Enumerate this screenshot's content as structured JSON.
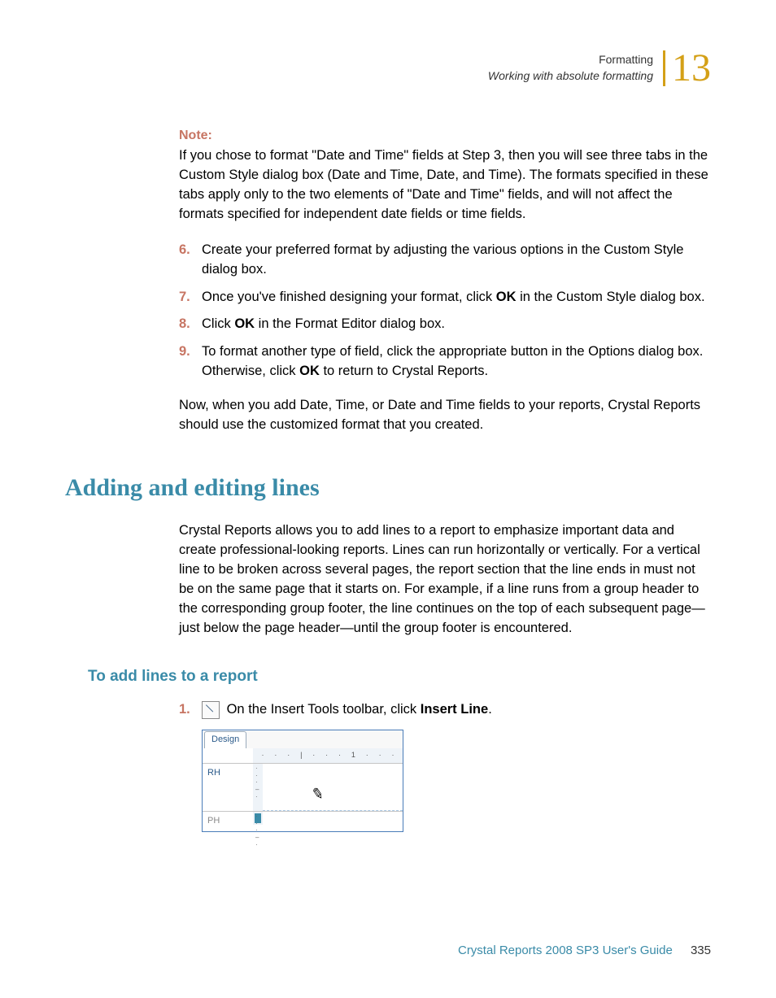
{
  "header": {
    "title": "Formatting",
    "subtitle": "Working with absolute formatting",
    "chapter": "13"
  },
  "note": {
    "label": "Note:",
    "text": "If you chose to format \"Date and Time\" fields at Step 3, then you will see three tabs in the Custom Style dialog box (Date and Time, Date, and Time). The formats specified in these tabs apply only to the two elements of \"Date and Time\" fields, and will not affect the formats specified for independent date fields or time fields."
  },
  "steps": [
    {
      "num": "6.",
      "text": "Create your preferred format by adjusting the various options in the Custom Style dialog box."
    },
    {
      "num": "7.",
      "pre": "Once you've finished designing your format, click ",
      "bold": "OK",
      "post": " in the Custom Style dialog box."
    },
    {
      "num": "8.",
      "pre": "Click ",
      "bold": "OK",
      "post": " in the Format Editor dialog box."
    },
    {
      "num": "9.",
      "pre": "To format another type of field, click the appropriate button in the Options dialog box. Otherwise, click ",
      "bold": "OK",
      "post": " to return to Crystal Reports."
    }
  ],
  "closing": "Now, when you add Date, Time, or Date and Time fields to your reports, Crystal Reports should use the customized format that you created.",
  "section": {
    "heading": "Adding and editing lines",
    "body": "Crystal Reports allows you to add lines to a report to emphasize important data and create professional-looking reports. Lines can run horizontally or vertically. For a vertical line to be broken across several pages, the report section that the line ends in must not be on the same page that it starts on. For example, if a line runs from a group header to the corresponding group footer, the line continues on the top of each subsequent page—just below the page header—until the group footer is encountered."
  },
  "subheading": "To add lines to a report",
  "substep": {
    "num": "1.",
    "pre": " On the Insert Tools toolbar, click ",
    "bold": "Insert Line",
    "post": "."
  },
  "preview": {
    "tab": "Design",
    "ruler_mark": "1",
    "row1": "RH",
    "row2": "PH"
  },
  "footer": {
    "title": "Crystal Reports 2008 SP3 User's Guide",
    "page": "335"
  }
}
